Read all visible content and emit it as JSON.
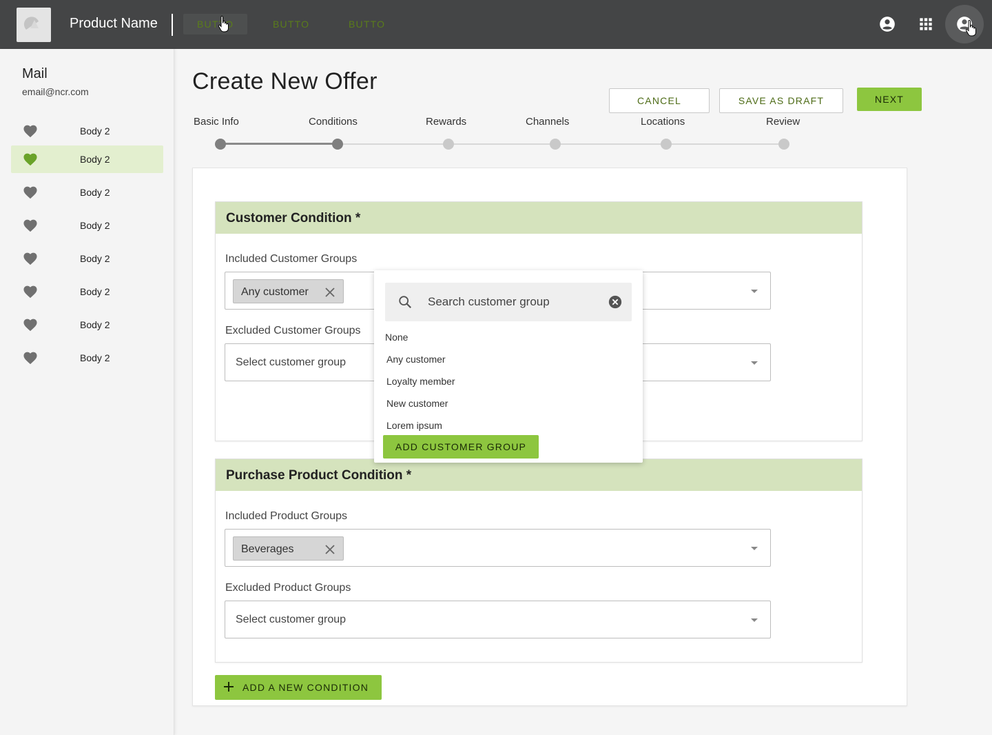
{
  "topbar": {
    "product_name": "Product Name",
    "nav_buttons": [
      "BUTTO",
      "BUTTO",
      "BUTTO"
    ],
    "icons": [
      "logo",
      "account-circle-icon",
      "apps-grid-icon",
      "account-switch-icon"
    ]
  },
  "sidebar": {
    "title": "Mail",
    "email": "email@ncr.com",
    "items": [
      {
        "label": "Body 2",
        "active": false
      },
      {
        "label": "Body 2",
        "active": true
      },
      {
        "label": "Body 2",
        "active": false
      },
      {
        "label": "Body 2",
        "active": false
      },
      {
        "label": "Body 2",
        "active": false
      },
      {
        "label": "Body 2",
        "active": false
      },
      {
        "label": "Body 2",
        "active": false
      },
      {
        "label": "Body 2",
        "active": false
      }
    ]
  },
  "page": {
    "title": "Create New Offer",
    "actions": {
      "cancel": "CANCEL",
      "save_draft": "SAVE AS DRAFT",
      "next": "NEXT"
    },
    "steps": [
      "Basic Info",
      "Conditions",
      "Rewards",
      "Channels",
      "Locations",
      "Review"
    ],
    "current_step": 2
  },
  "customer_condition": {
    "title": "Customer Condition *",
    "included_label": "Included Customer Groups",
    "included_chip": "Any customer",
    "excluded_label": "Excluded Customer Groups",
    "excluded_placeholder": "Select customer group"
  },
  "dropdown": {
    "search_placeholder": "Search customer group",
    "options": [
      "None",
      "Any customer",
      "Loyalty member",
      "New customer",
      "Lorem ipsum"
    ],
    "add_button": "ADD CUSTOMER GROUP"
  },
  "product_condition": {
    "title": "Purchase Product Condition *",
    "included_label": "Included Product Groups",
    "included_chip": "Beverages",
    "excluded_label": "Excluded Product Groups",
    "excluded_placeholder": "Select customer group"
  },
  "add_condition": "ADD A NEW CONDITION",
  "colors": {
    "topbar": "#444546",
    "accent": "#8dc63f",
    "section_header": "#d5e3bd",
    "active_nav": "#e3efcf"
  }
}
